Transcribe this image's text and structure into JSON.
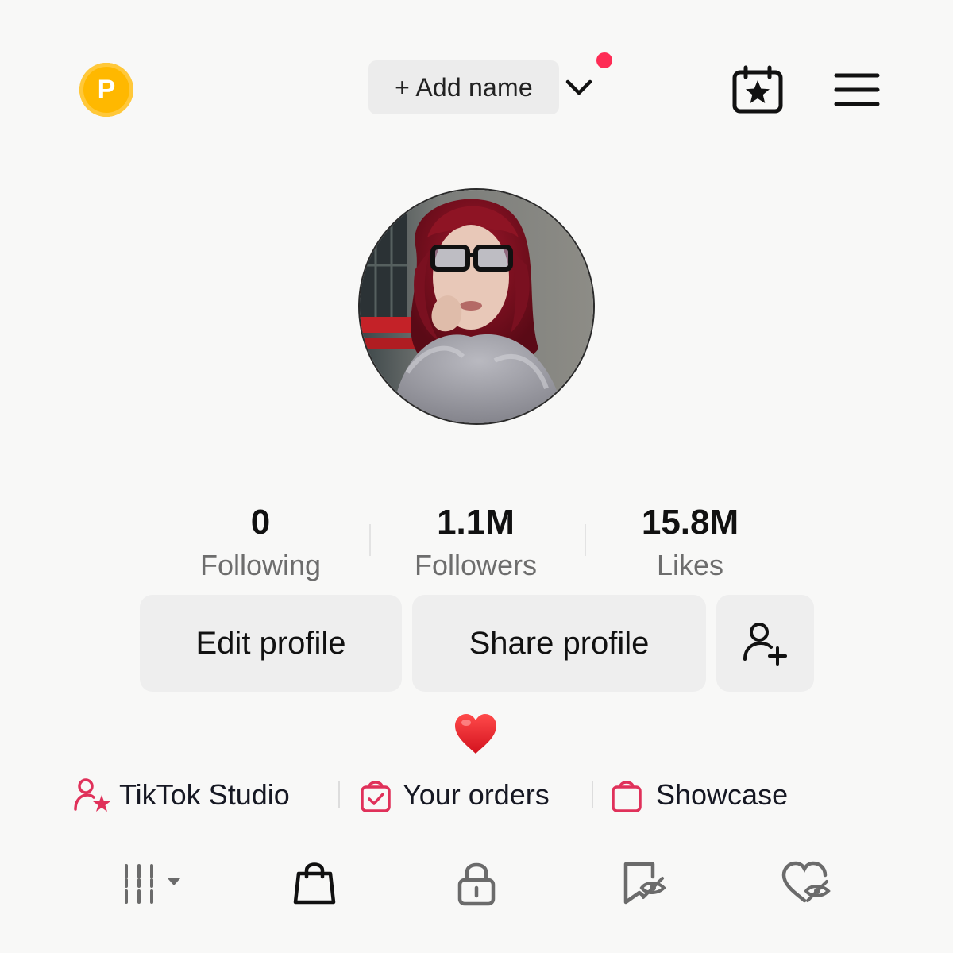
{
  "header": {
    "coin_letter": "P",
    "add_name_label": "+ Add name"
  },
  "stats": [
    {
      "value": "0",
      "label": "Following"
    },
    {
      "value": "1.1M",
      "label": "Followers"
    },
    {
      "value": "15.8M",
      "label": "Likes"
    }
  ],
  "actions": {
    "edit_profile": "Edit profile",
    "share_profile": "Share profile"
  },
  "bio": {
    "emoji": "heart"
  },
  "links": [
    {
      "label": "TikTok Studio",
      "icon": "creator-star-icon"
    },
    {
      "label": "Your orders",
      "icon": "orders-bag-icon"
    },
    {
      "label": "Showcase",
      "icon": "showcase-bag-icon"
    }
  ],
  "tabs": [
    {
      "icon": "grid-icon",
      "active": false
    },
    {
      "icon": "shopping-bag-icon",
      "active": true
    },
    {
      "icon": "lock-icon",
      "active": false
    },
    {
      "icon": "saved-hidden-icon",
      "active": false
    },
    {
      "icon": "liked-hidden-icon",
      "active": false
    }
  ],
  "colors": {
    "accent": "#fe2c55",
    "coin": "#ffb800",
    "link_icon": "#e0315a"
  }
}
